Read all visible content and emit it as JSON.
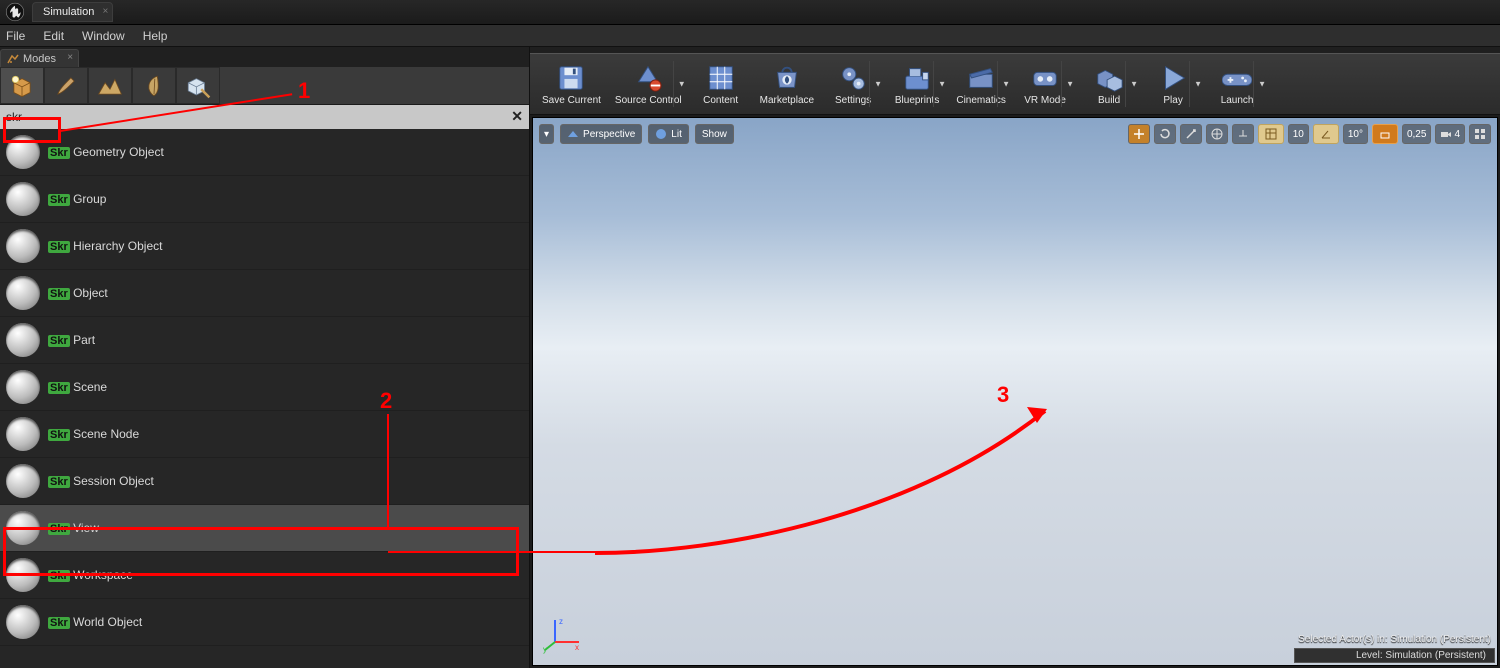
{
  "title_tab": "Simulation",
  "menu": {
    "file": "File",
    "edit": "Edit",
    "window": "Window",
    "help": "Help"
  },
  "left_panel": {
    "tab": "Modes",
    "search_value": "skr"
  },
  "search_hl": "Skr",
  "results": [
    {
      "rest": " Geometry Object"
    },
    {
      "rest": " Group"
    },
    {
      "rest": " Hierarchy Object"
    },
    {
      "rest": " Object"
    },
    {
      "rest": " Part"
    },
    {
      "rest": " Scene"
    },
    {
      "rest": " Scene Node"
    },
    {
      "rest": " Session Object"
    },
    {
      "rest": " View"
    },
    {
      "rest": " Workspace"
    },
    {
      "rest": " World Object"
    }
  ],
  "toolbar": {
    "save": "Save Current",
    "source": "Source Control",
    "content": "Content",
    "marketplace": "Marketplace",
    "settings": "Settings",
    "blueprints": "Blueprints",
    "cinematics": "Cinematics",
    "vrmode": "VR Mode",
    "build": "Build",
    "play": "Play",
    "launch": "Launch"
  },
  "viewport": {
    "perspective": "Perspective",
    "lit": "Lit",
    "show": "Show",
    "snap_pos": "10",
    "snap_rot": "10°",
    "snap_scale": "0,25",
    "cam_speed": "4"
  },
  "status": {
    "line1": "Selected Actor(s) in:  Simulation (Persistent)",
    "line2": "Level:  Simulation (Persistent)"
  },
  "annotations": {
    "n1": "1",
    "n2": "2",
    "n3": "3"
  }
}
